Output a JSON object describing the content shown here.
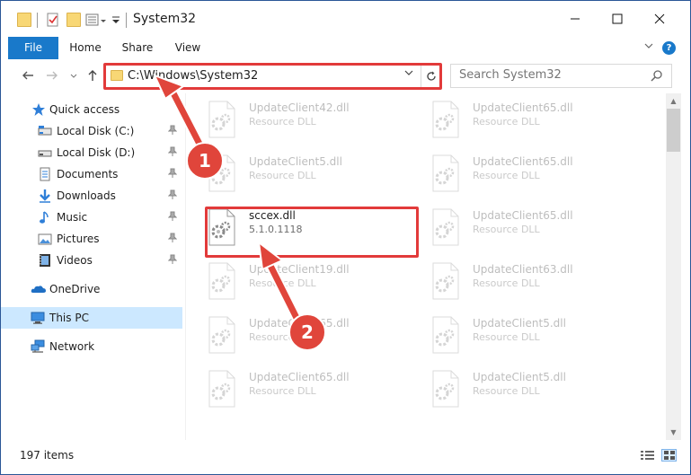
{
  "window": {
    "title": "System32"
  },
  "ribbon": {
    "tabs": [
      {
        "label": "File"
      },
      {
        "label": "Home"
      },
      {
        "label": "Share"
      },
      {
        "label": "View"
      }
    ],
    "help": "?"
  },
  "address": {
    "path": "C:\\Windows\\System32",
    "search_placeholder": "Search System32"
  },
  "sidebar": {
    "items": [
      {
        "label": "Quick access",
        "icon": "star-icon",
        "pinned": false
      },
      {
        "label": "Local Disk (C:)",
        "icon": "drive-icon",
        "pinned": true
      },
      {
        "label": "Local Disk (D:)",
        "icon": "drive-icon",
        "pinned": true
      },
      {
        "label": "Documents",
        "icon": "documents-icon",
        "pinned": true
      },
      {
        "label": "Downloads",
        "icon": "downloads-icon",
        "pinned": true
      },
      {
        "label": "Music",
        "icon": "music-icon",
        "pinned": true
      },
      {
        "label": "Pictures",
        "icon": "pictures-icon",
        "pinned": true
      },
      {
        "label": "Videos",
        "icon": "videos-icon",
        "pinned": true
      },
      {
        "label": "OneDrive",
        "icon": "onedrive-icon",
        "pinned": false
      },
      {
        "label": "This PC",
        "icon": "this-pc-icon",
        "pinned": false,
        "selected": true
      },
      {
        "label": "Network",
        "icon": "network-icon",
        "pinned": false
      }
    ]
  },
  "files": [
    {
      "name": "UpdateClient42.dll",
      "desc": "Resource DLL",
      "faded": true
    },
    {
      "name": "UpdateClient65.dll",
      "desc": "Resource DLL",
      "faded": true
    },
    {
      "name": "UpdateClient5.dll",
      "desc": "Resource DLL",
      "faded": true
    },
    {
      "name": "UpdateClient65.dll",
      "desc": "Resource DLL",
      "faded": true
    },
    {
      "name": "sccex.dll",
      "desc": "5.1.0.1118",
      "faded": false
    },
    {
      "name": "UpdateClient65.dll",
      "desc": "Resource DLL",
      "faded": true
    },
    {
      "name": "UpdateClient19.dll",
      "desc": "Resource DLL",
      "faded": true
    },
    {
      "name": "UpdateClient63.dll",
      "desc": "Resource DLL",
      "faded": true
    },
    {
      "name": "UpdateClient65.dll",
      "desc": "Resource DLL",
      "faded": true
    },
    {
      "name": "UpdateClient5.dll",
      "desc": "Resource DLL",
      "faded": true
    },
    {
      "name": "UpdateClient65.dll",
      "desc": "Resource DLL",
      "faded": true
    },
    {
      "name": "UpdateClient5.dll",
      "desc": "Resource DLL",
      "faded": true
    }
  ],
  "status": {
    "item_count": "197 items"
  },
  "annotations": {
    "badge1": "1",
    "badge2": "2",
    "arrow_color": "#e0453b",
    "highlight_color": "#e23a3a"
  },
  "colors": {
    "accent": "#1979ca",
    "selected_bg": "#cce8ff"
  }
}
